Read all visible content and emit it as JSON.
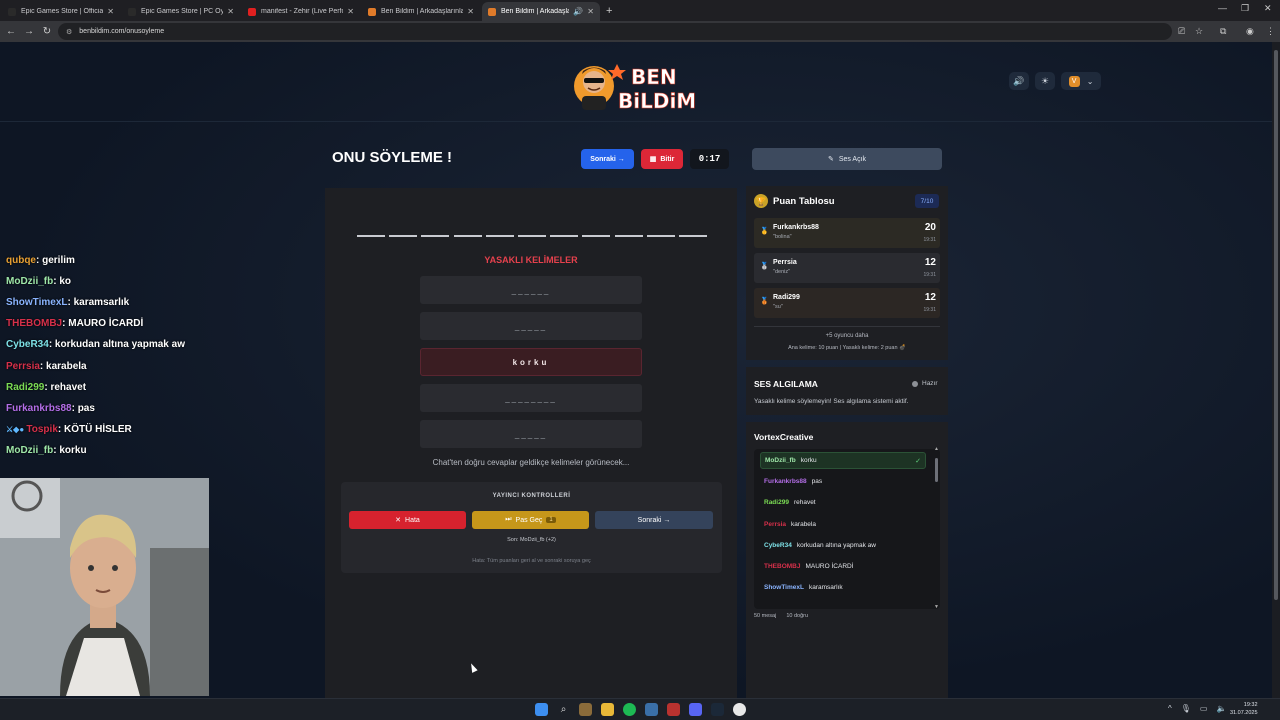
{
  "browser": {
    "tabs": [
      {
        "label": "Epic Games Store | Official Site",
        "color": "#2a2a2a"
      },
      {
        "label": "Epic Games Store | PC Oyunları",
        "color": "#2a2a2a"
      },
      {
        "label": "manifest - Zehir (Live Performa",
        "color": "#e02020"
      },
      {
        "label": "Ben Bildim | Arkadaşlarınla Onl",
        "color": "#e07b2a"
      },
      {
        "label": "Ben Bildim | Arkadaşlarınla",
        "color": "#e07b2a"
      }
    ],
    "url": "benbildim.com/onusoyleme"
  },
  "header": {
    "logo_line1": "BEN",
    "logo_line2": "BiLDiM",
    "profile_initial": "V"
  },
  "game": {
    "title": "ONU SÖYLEME !",
    "next_label": "Sonraki →",
    "finish_label": "Bitir",
    "timer": "0:17",
    "banned_title": "YASAKLI KELİMELER",
    "banned": [
      "______",
      "_____",
      "korku",
      "________",
      "_____"
    ],
    "chat_hint": "Chat'ten doğru cevaplar geldikçe kelimeler görünecek...",
    "controls_title": "YAYINCI KONTROLLERİ",
    "error_label": "Hata",
    "pass_label": "Pas Geç",
    "pass_count": "1",
    "next2_label": "Sonraki →",
    "last": "Son: MoDzii_fb (+2)",
    "note": "Hata: Tüm puanları geri al ve sonraki soruya geç"
  },
  "right": {
    "ses_button": "Ses Açık",
    "score_title": "Puan Tablosu",
    "score_count": "7/10",
    "ranks": [
      {
        "name": "Furkankrbs88",
        "word": "\"bolina\"",
        "points": "20",
        "time": "19:31",
        "medal": "🥇"
      },
      {
        "name": "Perrsia",
        "word": "\"deniz\"",
        "points": "12",
        "time": "19:31",
        "medal": "🥈"
      },
      {
        "name": "Radi299",
        "word": "\"su\"",
        "points": "12",
        "time": "19:31",
        "medal": "🥉"
      }
    ],
    "more": "+5 oyuncu daha",
    "rule": "Ana kelime: 10 puan | Yasaklı kelime: 2 puan 💣",
    "sa_title": "SES ALGILAMA",
    "sa_status": "Hazır",
    "sa_desc": "Yasaklı kelime söylemeyin! Ses algılama sistemi aktif.",
    "vc_title": "VortexCreative",
    "vc_msgs": [
      {
        "user": "MoDzii_fb",
        "msg": "korku",
        "color": "#9ee6a8",
        "ok": true
      },
      {
        "user": "Furkankrbs88",
        "msg": "pas",
        "color": "#b46ee8",
        "ok": false
      },
      {
        "user": "Radi299",
        "msg": "rehavet",
        "color": "#7bdc54",
        "ok": false
      },
      {
        "user": "Perrsia",
        "msg": "karabela",
        "color": "#d6304a",
        "ok": false
      },
      {
        "user": "CybeR34",
        "msg": "korkudan altına yapmak aw",
        "color": "#7de0e6",
        "ok": false
      },
      {
        "user": "THEBOMBJ",
        "msg": "MAURO İCARDİ",
        "color": "#d6304a",
        "ok": false
      },
      {
        "user": "ShowTimexL",
        "msg": "karamsarlık",
        "color": "#8ab4ff",
        "ok": false
      }
    ],
    "vc_stat1": "50 mesaj",
    "vc_stat2": "10 doğru"
  },
  "stream_chat": [
    {
      "user": "qubqe",
      "msg": ": gerilim",
      "color": "#e8a033"
    },
    {
      "user": "MoDzii_fb",
      "msg": ": ko",
      "color": "#9ee6a8"
    },
    {
      "user": "ShowTimexL",
      "msg": ": karamsarlık",
      "color": "#8ab4ff"
    },
    {
      "user": "THEBOMBJ",
      "msg": ": MAURO İCARDİ",
      "color": "#d6304a"
    },
    {
      "user": "CybeR34",
      "msg": ": korkudan altına yapmak aw",
      "color": "#7de0e6"
    },
    {
      "user": "Perrsia",
      "msg": ": karabela",
      "color": "#d6304a"
    },
    {
      "user": "Radi299",
      "msg": ": rehavet",
      "color": "#7bdc54"
    },
    {
      "user": "Furkankrbs88",
      "msg": ": pas",
      "color": "#b46ee8"
    },
    {
      "user": "Tospik",
      "msg": ": KÖTÜ HİSLER",
      "color": "#d6304a"
    },
    {
      "user": "MoDzii_fb",
      "msg": ": korku",
      "color": "#9ee6a8"
    }
  ],
  "taskbar": {
    "time": "19:32",
    "date": "31.07.2025"
  }
}
